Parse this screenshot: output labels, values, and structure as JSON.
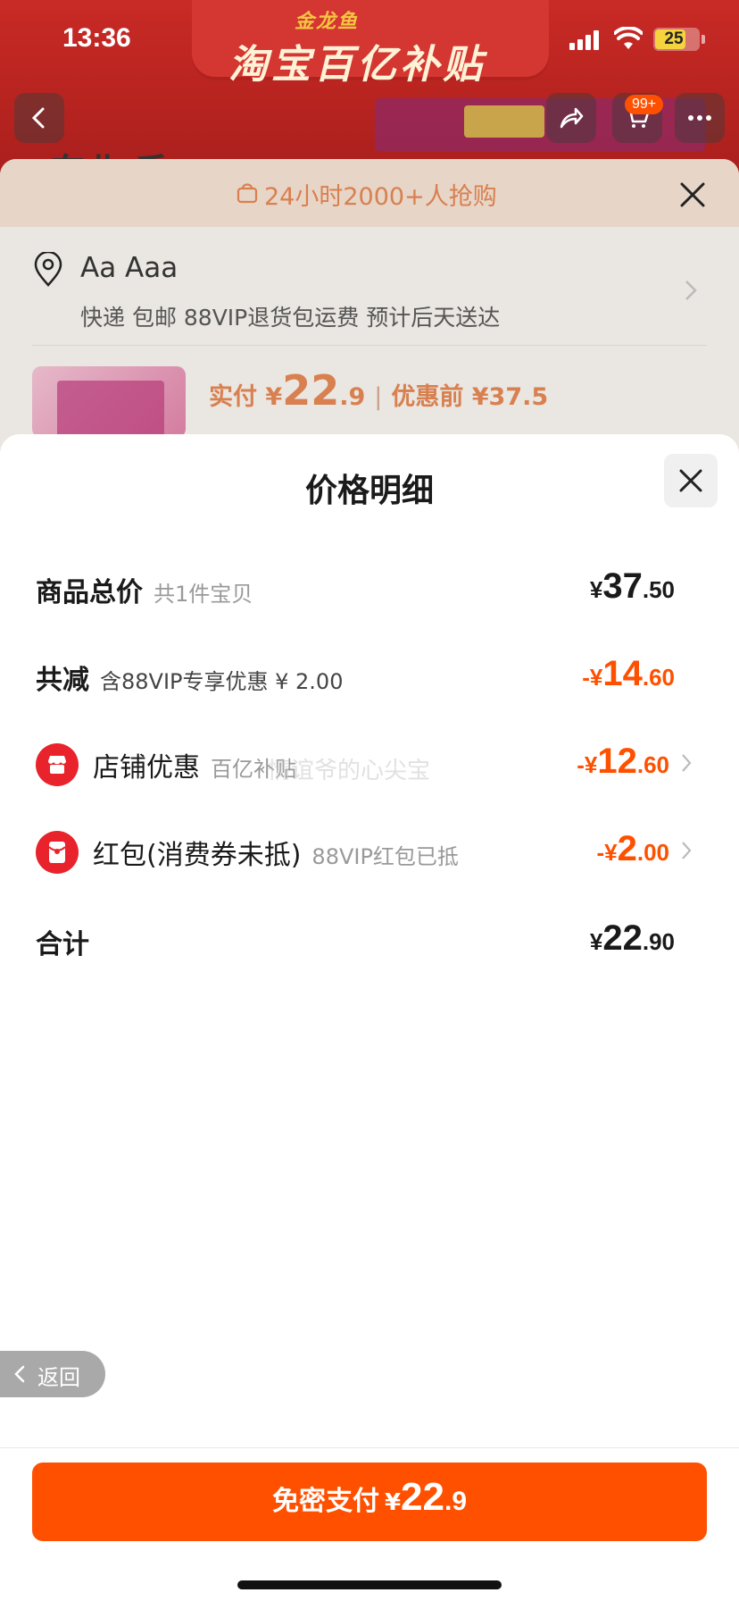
{
  "status_bar": {
    "time": "13:36",
    "battery": "25"
  },
  "background": {
    "brand": "金龙鱼",
    "banner_title": "淘宝百亿补贴",
    "cart_badge": "99+",
    "product_heading": "东北 香"
  },
  "order_sheet": {
    "banner": "24小时2000+人抢购",
    "address_name": "Aa Aaa",
    "address_detail": "快递 包邮 88VIP退货包运费 预计后天送达",
    "pay_label": "实付 ¥",
    "pay_int": "22",
    "pay_dec": ".9",
    "pay_before": "优惠前 ¥37.5"
  },
  "price_detail": {
    "title": "价格明细",
    "rows": [
      {
        "label": "商品总价",
        "sub": "共1件宝贝",
        "cur": "¥",
        "int": "37",
        "dec": ".50"
      },
      {
        "label": "共减",
        "sub": "含88VIP专享优惠 ¥ 2.00",
        "cur": "-¥",
        "int": "14",
        "dec": ".60"
      },
      {
        "label": "店铺优惠",
        "sub": "百亿补贴",
        "cur": "-¥",
        "int": "12",
        "dec": ".60"
      },
      {
        "label": "红包(消费券未抵)",
        "sub": "88VIP红包已抵",
        "cur": "-¥",
        "int": "2",
        "dec": ".00"
      },
      {
        "label": "合计",
        "sub": "",
        "cur": "¥",
        "int": "22",
        "dec": ".90"
      }
    ],
    "watermark": "情谊爷的心尖宝"
  },
  "back_pill": {
    "label": "返回"
  },
  "pay_button": {
    "label": "免密支付",
    "cur": "¥",
    "int": "22",
    "dec": ".9"
  },
  "colors": {
    "accent": "#ff5000",
    "icon_red": "#e8232c"
  },
  "icons": [
    "bag-icon",
    "close-icon",
    "location-pin-icon",
    "chevron-right-icon",
    "shop-icon",
    "red-packet-icon",
    "back-arrow-icon",
    "share-icon",
    "cart-icon",
    "more-icon",
    "wifi-icon",
    "signal-icon",
    "battery-icon"
  ]
}
